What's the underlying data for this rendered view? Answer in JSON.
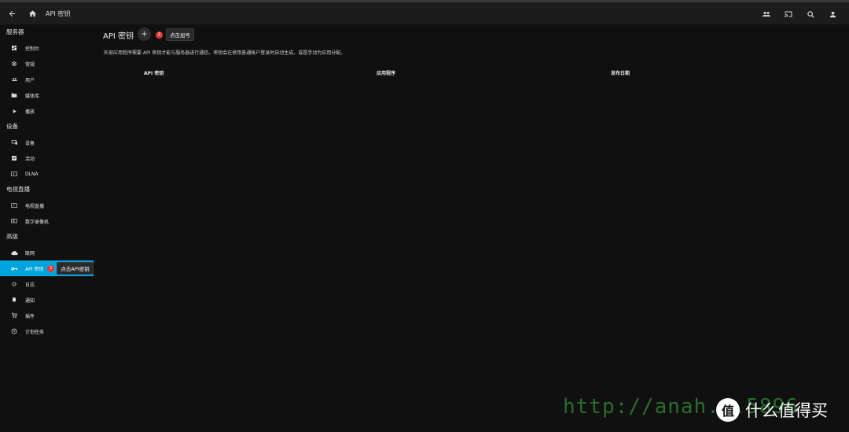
{
  "header": {
    "title": "API 密钥"
  },
  "sidebar": {
    "sections": [
      {
        "title": "服务器",
        "items": [
          {
            "label": "控制台",
            "icon": "dashboard-icon"
          },
          {
            "label": "常规",
            "icon": "settings-icon"
          },
          {
            "label": "用户",
            "icon": "users-icon"
          },
          {
            "label": "媒体库",
            "icon": "folder-icon"
          },
          {
            "label": "播放",
            "icon": "play-icon"
          }
        ]
      },
      {
        "title": "设备",
        "items": [
          {
            "label": "设备",
            "icon": "devices-icon"
          },
          {
            "label": "活动",
            "icon": "activity-icon"
          },
          {
            "label": "DLNA",
            "icon": "dlna-icon"
          }
        ]
      },
      {
        "title": "电视直播",
        "items": [
          {
            "label": "电视直播",
            "icon": "live-tv-icon"
          },
          {
            "label": "数字录像机",
            "icon": "dvr-icon"
          }
        ]
      },
      {
        "title": "高级",
        "items": [
          {
            "label": "联网",
            "icon": "cloud-icon"
          },
          {
            "label": "API 密钥",
            "icon": "key-icon"
          },
          {
            "label": "日志",
            "icon": "log-icon"
          },
          {
            "label": "通知",
            "icon": "bell-icon"
          },
          {
            "label": "插件",
            "icon": "cart-icon"
          },
          {
            "label": "计划任务",
            "icon": "clock-icon"
          }
        ]
      }
    ],
    "active_badge": "1",
    "active_tip": "点击API密钥"
  },
  "main": {
    "title": "API 密钥",
    "add_label": "+",
    "hint_badge": "2",
    "hint_text": "点击加号",
    "description": "外部应用程序需要 API 密钥才能与服务器进行通信。密钥会在使用普通帐户登录时自动生成，或是手动为应用分配。",
    "columns": [
      "API 密钥",
      "应用程序",
      "发布日期"
    ]
  },
  "watermark": {
    "url_text": "http://anah...5896",
    "logo_glyph": "值",
    "logo_text": "什么值得买"
  },
  "colors": {
    "accent": "#00a4dc",
    "badge": "#e53935",
    "background": "#101010"
  }
}
